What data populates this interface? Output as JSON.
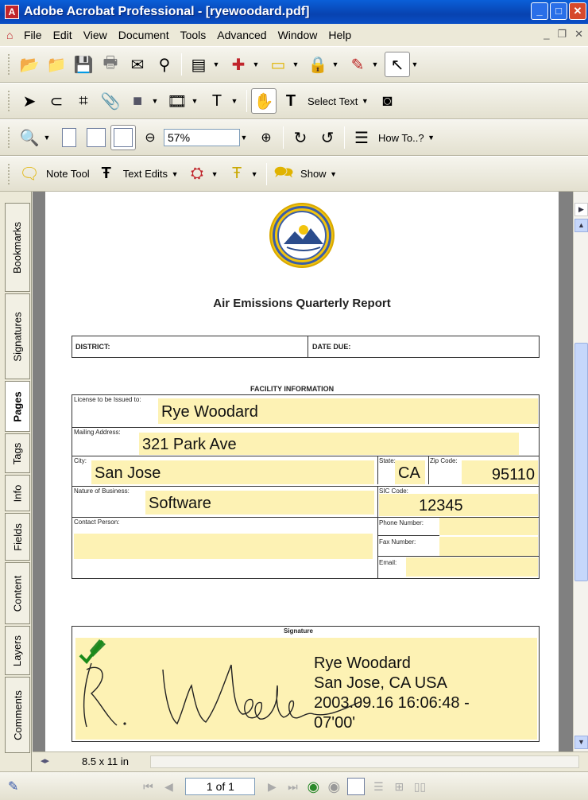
{
  "window": {
    "title": "Adobe Acrobat Professional - [ryewoodard.pdf]"
  },
  "menu": {
    "items": [
      "File",
      "Edit",
      "View",
      "Document",
      "Tools",
      "Advanced",
      "Window",
      "Help"
    ]
  },
  "toolbar": {
    "select_text_label": "Select Text",
    "zoom_value": "57%",
    "howto_label": "How To..?",
    "note_tool_label": "Note Tool",
    "text_edits_label": "Text Edits",
    "show_label": "Show"
  },
  "nav_tabs": [
    "Bookmarks",
    "Signatures",
    "Pages",
    "Tags",
    "Info",
    "Fields",
    "Content",
    "Layers",
    "Comments"
  ],
  "document": {
    "title": "Air Emissions Quarterly Report",
    "district_label": "DISTRICT:",
    "date_due_label": "DATE DUE:",
    "facility_heading": "FACILITY INFORMATION",
    "license_label": "License to be Issued to:",
    "license_value": "Rye Woodard",
    "mailing_label": "Mailing Address:",
    "mailing_value": "321 Park Ave",
    "city_label": "City:",
    "city_value": "San Jose",
    "state_label": "State:",
    "state_value": "CA",
    "zip_label": "Zip Code:",
    "zip_value": "95110",
    "business_label": "Nature of Business:",
    "business_value": "Software",
    "sic_label": "SIC Code:",
    "sic_value": "12345",
    "contact_label": "Contact Person:",
    "phone_label": "Phone Number:",
    "fax_label": "Fax Number:",
    "email_label": "Email:",
    "signature_heading": "Signature",
    "signature_lines": [
      "Rye Woodard",
      "San Jose, CA USA",
      "2003.09.16 16:06:48 -",
      "07'00'"
    ]
  },
  "status": {
    "page_size": "8.5 x 11 in",
    "page_of": "1 of 1"
  }
}
